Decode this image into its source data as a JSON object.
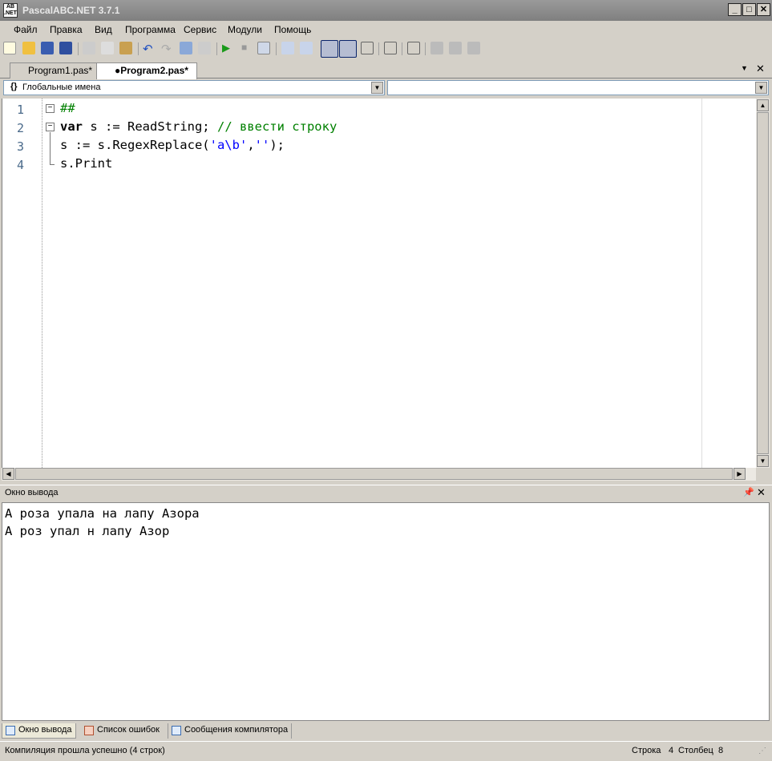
{
  "window": {
    "title": "PascalABC.NET 3.7.1",
    "logo_text": "AB\n.NET"
  },
  "menu": [
    "Файл",
    "Правка",
    "Вид",
    "Программа",
    "Сервис",
    "Модули",
    "Помощь"
  ],
  "toolbar": [
    "new-file",
    "open",
    "save",
    "save-all",
    "cut",
    "copy",
    "paste",
    "undo",
    "redo",
    "format",
    "format-disabled",
    "run",
    "stop",
    "debug",
    "step-into",
    "step-over",
    "console-mode",
    "text-mode",
    "abc-cpp",
    "outline",
    "code",
    "designer-d",
    "designer-l",
    "designer-r"
  ],
  "tabs": [
    {
      "label": "Program1.pas*"
    },
    {
      "label": "●Program2.pas*"
    }
  ],
  "scope_combo": {
    "value": "Глобальные имена",
    "icon": "{}"
  },
  "editor": {
    "line_numbers": [
      "1",
      "2",
      "3",
      "4"
    ],
    "lines": {
      "l1": "##",
      "l2_kw": "var",
      " l2_rest": "",
      "l2_code": " s := ReadString; ",
      "l2_comment": "// ввести строку",
      "l3_a": "s := s.RegexReplace(",
      "l3_str1": "'a\\b'",
      "l3_comma": ",",
      "l3_str2": "''",
      "l3_end": ");",
      "l4": "s.Print"
    }
  },
  "output": {
    "title": "Окно вывода",
    "text": "А роза упала на лапу Азора\nА роз упал н лапу Азор"
  },
  "bottom_tabs": [
    "Окно вывода",
    "Список ошибок",
    "Сообщения компилятора"
  ],
  "status": {
    "message": "Компиляция прошла успешно (4 строк)",
    "row_label": "Строка",
    "row": "4",
    "col_label": "Столбец",
    "col": "8"
  }
}
